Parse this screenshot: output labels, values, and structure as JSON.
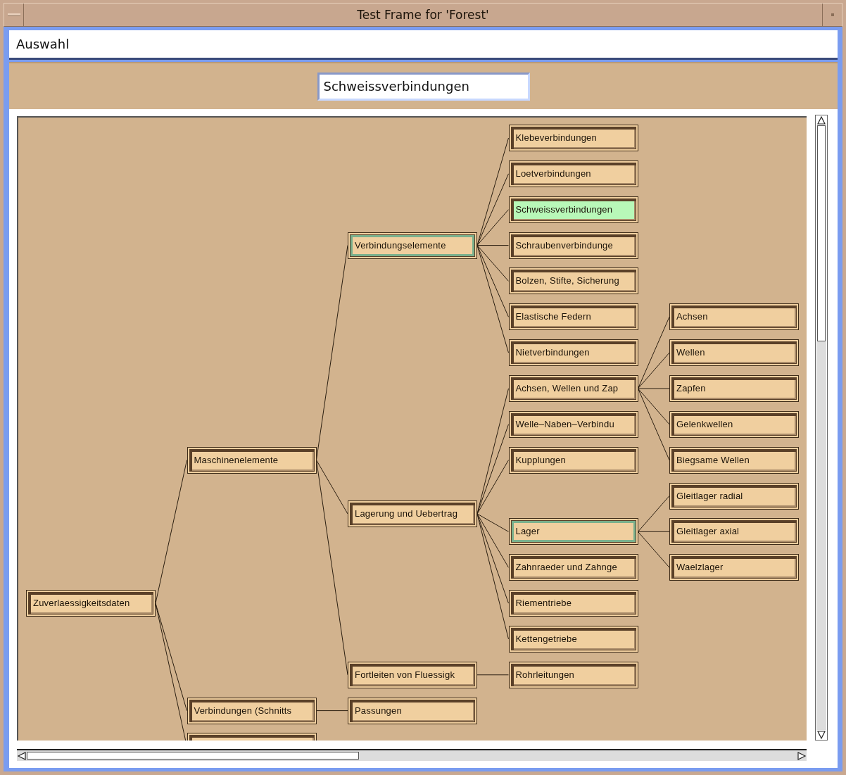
{
  "window": {
    "title": "Test Frame for 'Forest'"
  },
  "selection_label": "Auswahl",
  "selection_field": {
    "value": "Schweissverbindungen"
  },
  "tree": [
    {
      "label": "Zuverlaessigkeitsdaten",
      "selected": false,
      "highlighted": false,
      "children": [
        {
          "label": "Maschinenelemente",
          "selected": false,
          "highlighted": false,
          "children": [
            {
              "label": "Verbindungselemente",
              "selected": false,
              "highlighted": true,
              "children": [
                {
                  "label": "Klebeverbindungen",
                  "selected": false,
                  "highlighted": false
                },
                {
                  "label": "Loetverbindungen",
                  "selected": false,
                  "highlighted": false
                },
                {
                  "label": "Schweissverbindungen",
                  "selected": true,
                  "highlighted": false
                },
                {
                  "label": "Schraubenverbindunge",
                  "selected": false,
                  "highlighted": false
                },
                {
                  "label": "Bolzen, Stifte, Sicherung",
                  "selected": false,
                  "highlighted": false
                },
                {
                  "label": "Elastische Federn",
                  "selected": false,
                  "highlighted": false
                },
                {
                  "label": "Nietverbindungen",
                  "selected": false,
                  "highlighted": false
                }
              ]
            },
            {
              "label": "Lagerung und Uebertrag",
              "selected": false,
              "highlighted": false,
              "children": [
                {
                  "label": "Achsen, Wellen und Zap",
                  "selected": false,
                  "highlighted": false,
                  "children": [
                    {
                      "label": "Achsen",
                      "selected": false,
                      "highlighted": false
                    },
                    {
                      "label": "Wellen",
                      "selected": false,
                      "highlighted": false
                    },
                    {
                      "label": "Zapfen",
                      "selected": false,
                      "highlighted": false
                    },
                    {
                      "label": "Gelenkwellen",
                      "selected": false,
                      "highlighted": false
                    },
                    {
                      "label": "Biegsame Wellen",
                      "selected": false,
                      "highlighted": false
                    }
                  ]
                },
                {
                  "label": "Welle–Naben–Verbindu",
                  "selected": false,
                  "highlighted": false
                },
                {
                  "label": "Kupplungen",
                  "selected": false,
                  "highlighted": false
                },
                {
                  "label": "Lager",
                  "selected": false,
                  "highlighted": true,
                  "children": [
                    {
                      "label": "Gleitlager radial",
                      "selected": false,
                      "highlighted": false
                    },
                    {
                      "label": "Gleitlager axial",
                      "selected": false,
                      "highlighted": false
                    },
                    {
                      "label": "Waelzlager",
                      "selected": false,
                      "highlighted": false
                    }
                  ]
                },
                {
                  "label": "Zahnraeder und Zahnge",
                  "selected": false,
                  "highlighted": false
                },
                {
                  "label": "Riementriebe",
                  "selected": false,
                  "highlighted": false
                },
                {
                  "label": "Kettengetriebe",
                  "selected": false,
                  "highlighted": false
                }
              ]
            },
            {
              "label": "Fortleiten von Fluessigk",
              "selected": false,
              "highlighted": false,
              "children": [
                {
                  "label": "Rohrleitungen",
                  "selected": false,
                  "highlighted": false
                }
              ]
            }
          ]
        },
        {
          "label": "Verbindungen (Schnitts",
          "selected": false,
          "highlighted": false,
          "children": [
            {
              "label": "Passungen",
              "selected": false,
              "highlighted": false
            }
          ]
        },
        {
          "selected": false,
          "highlighted": false
        }
      ]
    }
  ]
}
